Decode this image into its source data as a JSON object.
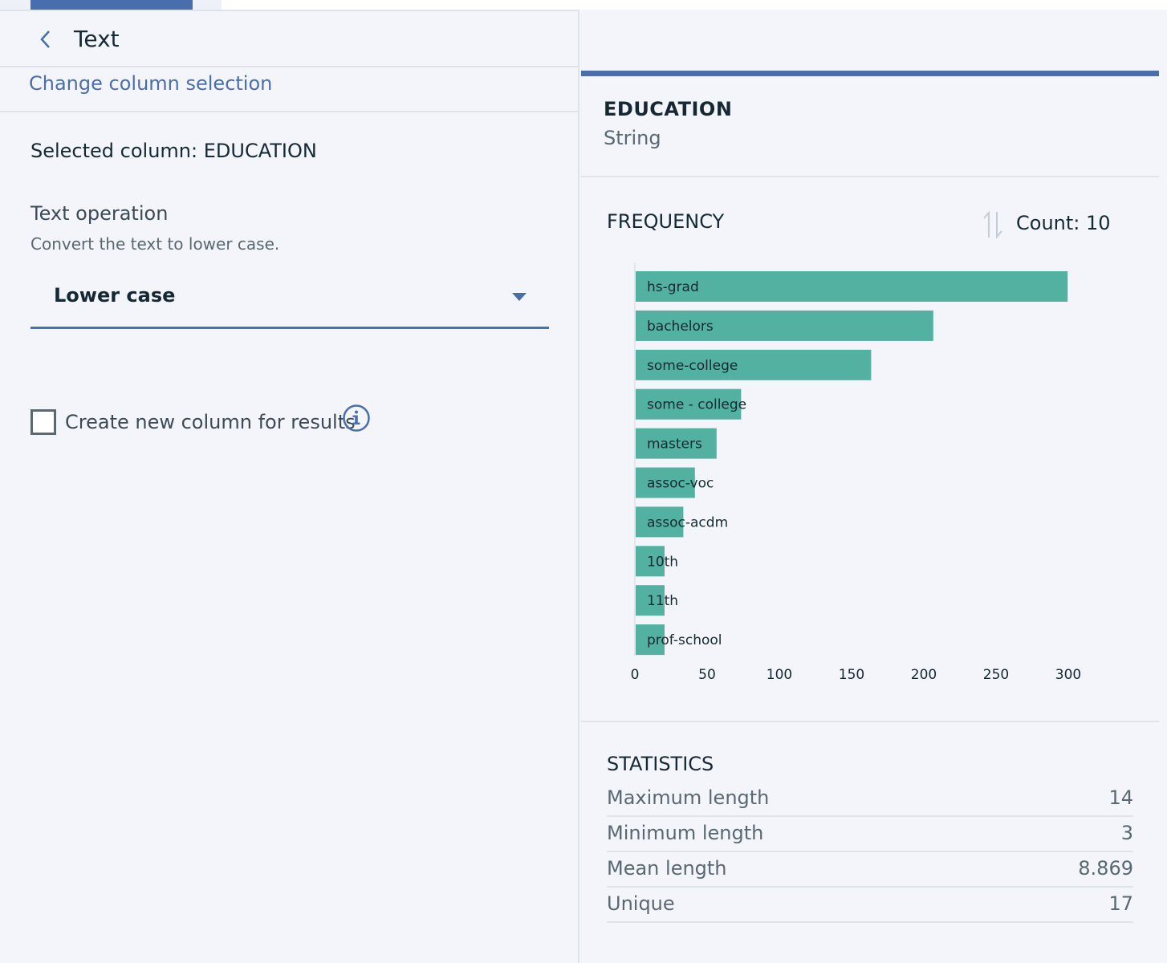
{
  "left": {
    "title": "Text",
    "change_link": "Change column selection",
    "selected_column": "Selected column: EDUCATION",
    "text_operation_label": "Text operation",
    "text_operation_desc": "Convert the text to lower case.",
    "dropdown_value": "Lower case",
    "checkbox_label": "Create new column for results",
    "checkbox_checked": false
  },
  "right": {
    "column_name": "EDUCATION",
    "column_type": "String",
    "frequency_title": "FREQUENCY",
    "count_label": "Count: 10",
    "statistics_title": "STATISTICS",
    "statistics": [
      {
        "label": "Maximum length",
        "value": "14"
      },
      {
        "label": "Minimum length",
        "value": "3"
      },
      {
        "label": "Mean length",
        "value": "8.869"
      },
      {
        "label": "Unique",
        "value": "17"
      }
    ]
  },
  "colors": {
    "accent": "#4a6ead",
    "bar": "#52b1a0"
  },
  "icons": {
    "back": "chevron-left-icon",
    "caret": "caret-down-icon",
    "info": "info-icon",
    "sort": "sort-icon"
  },
  "chart_data": {
    "type": "bar",
    "orientation": "horizontal",
    "categories": [
      "hs-grad",
      "bachelors",
      "some-college",
      "some - college",
      "masters",
      "assoc-voc",
      "assoc-acdm",
      "10th",
      "11th",
      "prof-school"
    ],
    "values": [
      299,
      206,
      163,
      73,
      56,
      41,
      33,
      20,
      20,
      20
    ],
    "xlim": [
      0,
      300
    ],
    "xticks": [
      "0",
      "50",
      "100",
      "150",
      "200",
      "250",
      "300"
    ],
    "title": "",
    "xlabel": "",
    "ylabel": ""
  }
}
